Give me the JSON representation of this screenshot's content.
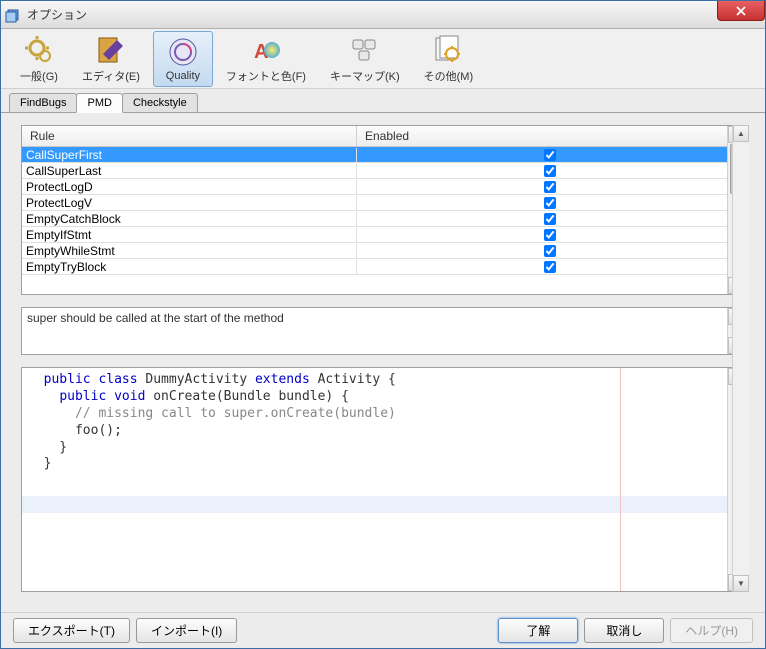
{
  "window": {
    "title": "オプション"
  },
  "toolbar": {
    "items": [
      {
        "label": "一般(G)"
      },
      {
        "label": "エディタ(E)"
      },
      {
        "label": "Quality"
      },
      {
        "label": "フォントと色(F)"
      },
      {
        "label": "キーマップ(K)"
      },
      {
        "label": "その他(M)"
      }
    ],
    "active_index": 2
  },
  "tabs": {
    "items": [
      "FindBugs",
      "PMD",
      "Checkstyle"
    ],
    "active_index": 1
  },
  "rules": {
    "columns": {
      "rule": "Rule",
      "enabled": "Enabled"
    },
    "rows": [
      {
        "name": "CallSuperFirst",
        "enabled": true,
        "selected": true
      },
      {
        "name": "CallSuperLast",
        "enabled": true,
        "selected": false
      },
      {
        "name": "ProtectLogD",
        "enabled": true,
        "selected": false
      },
      {
        "name": "ProtectLogV",
        "enabled": true,
        "selected": false
      },
      {
        "name": "EmptyCatchBlock",
        "enabled": true,
        "selected": false
      },
      {
        "name": "EmptyIfStmt",
        "enabled": true,
        "selected": false
      },
      {
        "name": "EmptyWhileStmt",
        "enabled": true,
        "selected": false
      },
      {
        "name": "EmptyTryBlock",
        "enabled": true,
        "selected": false
      }
    ]
  },
  "description": "super should be called at the start of the method",
  "code": {
    "lines": [
      {
        "indent": 1,
        "tokens": [
          [
            "kw",
            "public class"
          ],
          [
            "p",
            " DummyActivity "
          ],
          [
            "kw",
            "extends"
          ],
          [
            "p",
            " Activity {"
          ]
        ]
      },
      {
        "indent": 2,
        "tokens": [
          [
            "kw",
            "public void"
          ],
          [
            "p",
            " onCreate(Bundle bundle) {"
          ]
        ]
      },
      {
        "indent": 3,
        "tokens": [
          [
            "cm",
            "// missing call to super.onCreate(bundle)"
          ]
        ]
      },
      {
        "indent": 3,
        "tokens": [
          [
            "p",
            "foo();"
          ]
        ]
      },
      {
        "indent": 2,
        "tokens": [
          [
            "p",
            "}"
          ]
        ]
      },
      {
        "indent": 1,
        "tokens": [
          [
            "p",
            "}"
          ]
        ]
      }
    ]
  },
  "buttons": {
    "export": "エクスポート(T)",
    "import": "インポート(I)",
    "ok": "了解",
    "cancel": "取消し",
    "help": "ヘルプ(H)"
  }
}
